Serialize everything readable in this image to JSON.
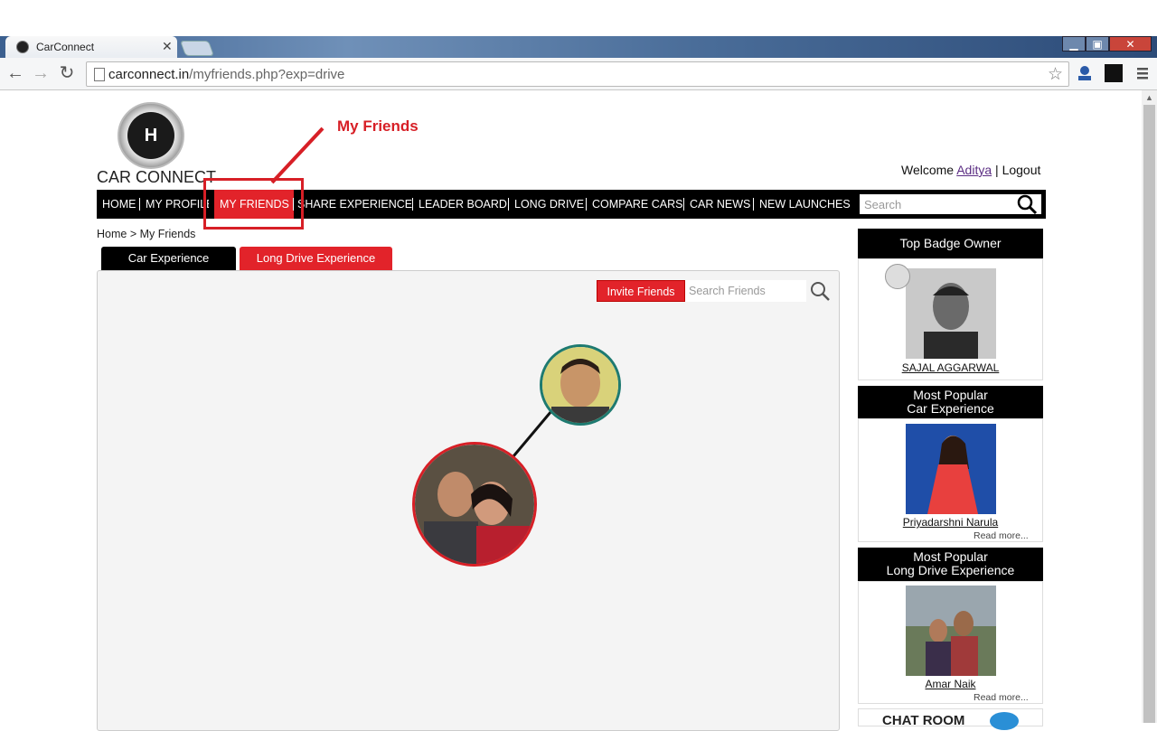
{
  "browser": {
    "tab_title": "CarConnect",
    "tab_close": "✕",
    "url_domain": "carconnect.in",
    "url_path": "/myfriends.php?exp=drive",
    "win_min": "▁",
    "win_max": "▣",
    "win_close": "✕"
  },
  "site": {
    "logo_text": "CAR CONNECT",
    "logo_glyph": "H",
    "annotation_label": "My Friends",
    "welcome_prefix": "Welcome",
    "username": "Aditya",
    "separator": "|",
    "logout": "Logout",
    "search_placeholder": "Search"
  },
  "nav": {
    "items": [
      "HOME",
      "MY PROFILE",
      "MY FRIENDS",
      "SHARE EXPERIENCE",
      "LEADER BOARD",
      "LONG DRIVE",
      "COMPARE CARS",
      "CAR NEWS",
      "NEW LAUNCHES"
    ],
    "active": "MY FRIENDS"
  },
  "breadcrumb": "Home > My Friends",
  "tabs": {
    "car_experience": "Car Experience",
    "long_drive": "Long Drive Experience"
  },
  "friends_panel": {
    "invite_label": "Invite Friends",
    "search_placeholder": "Search Friends"
  },
  "sidebar": {
    "top_badge": {
      "title": "Top Badge Owner",
      "name": "SAJAL AGGARWAL"
    },
    "popular_car": {
      "title_line1": "Most Popular",
      "title_line2": "Car Experience",
      "name": "Priyadarshni Narula",
      "read_more": "Read more..."
    },
    "popular_drive": {
      "title_line1": "Most Popular",
      "title_line2": "Long Drive Experience",
      "name": "Amar Naik",
      "read_more": "Read more..."
    },
    "chat_room": "CHAT ROOM"
  },
  "colors": {
    "accent_red": "#e2232a",
    "nav_black": "#000000",
    "friend_ring_green": "#1e7a70",
    "friend_ring_red": "#d71f26"
  }
}
